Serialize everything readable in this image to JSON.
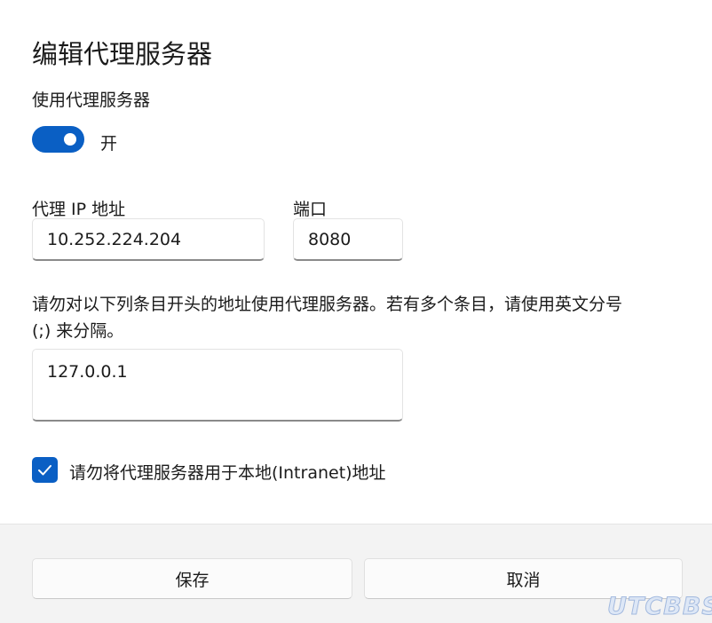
{
  "dialog": {
    "title": "编辑代理服务器",
    "use_proxy_label": "使用代理服务器",
    "toggle_state": "开",
    "ip_label": "代理 IP 地址",
    "ip_value": "10.252.224.204",
    "port_label": "端口",
    "port_value": "8080",
    "exceptions_description_line1": "请勿对以下列条目开头的地址使用代理服务器。若有多个条目，请使用英文分号",
    "exceptions_description_line2": "(;) 来分隔。",
    "exceptions_value": "127.0.0.1",
    "local_checkbox_label": "请勿将代理服务器用于本地(Intranet)地址",
    "local_checkbox_checked": true,
    "proxy_enabled": true
  },
  "footer": {
    "save_label": "保存",
    "cancel_label": "取消"
  },
  "watermark": "UTCBBS",
  "colors": {
    "accent": "#0a5fc4",
    "footer_bg": "#f3f3f3"
  }
}
